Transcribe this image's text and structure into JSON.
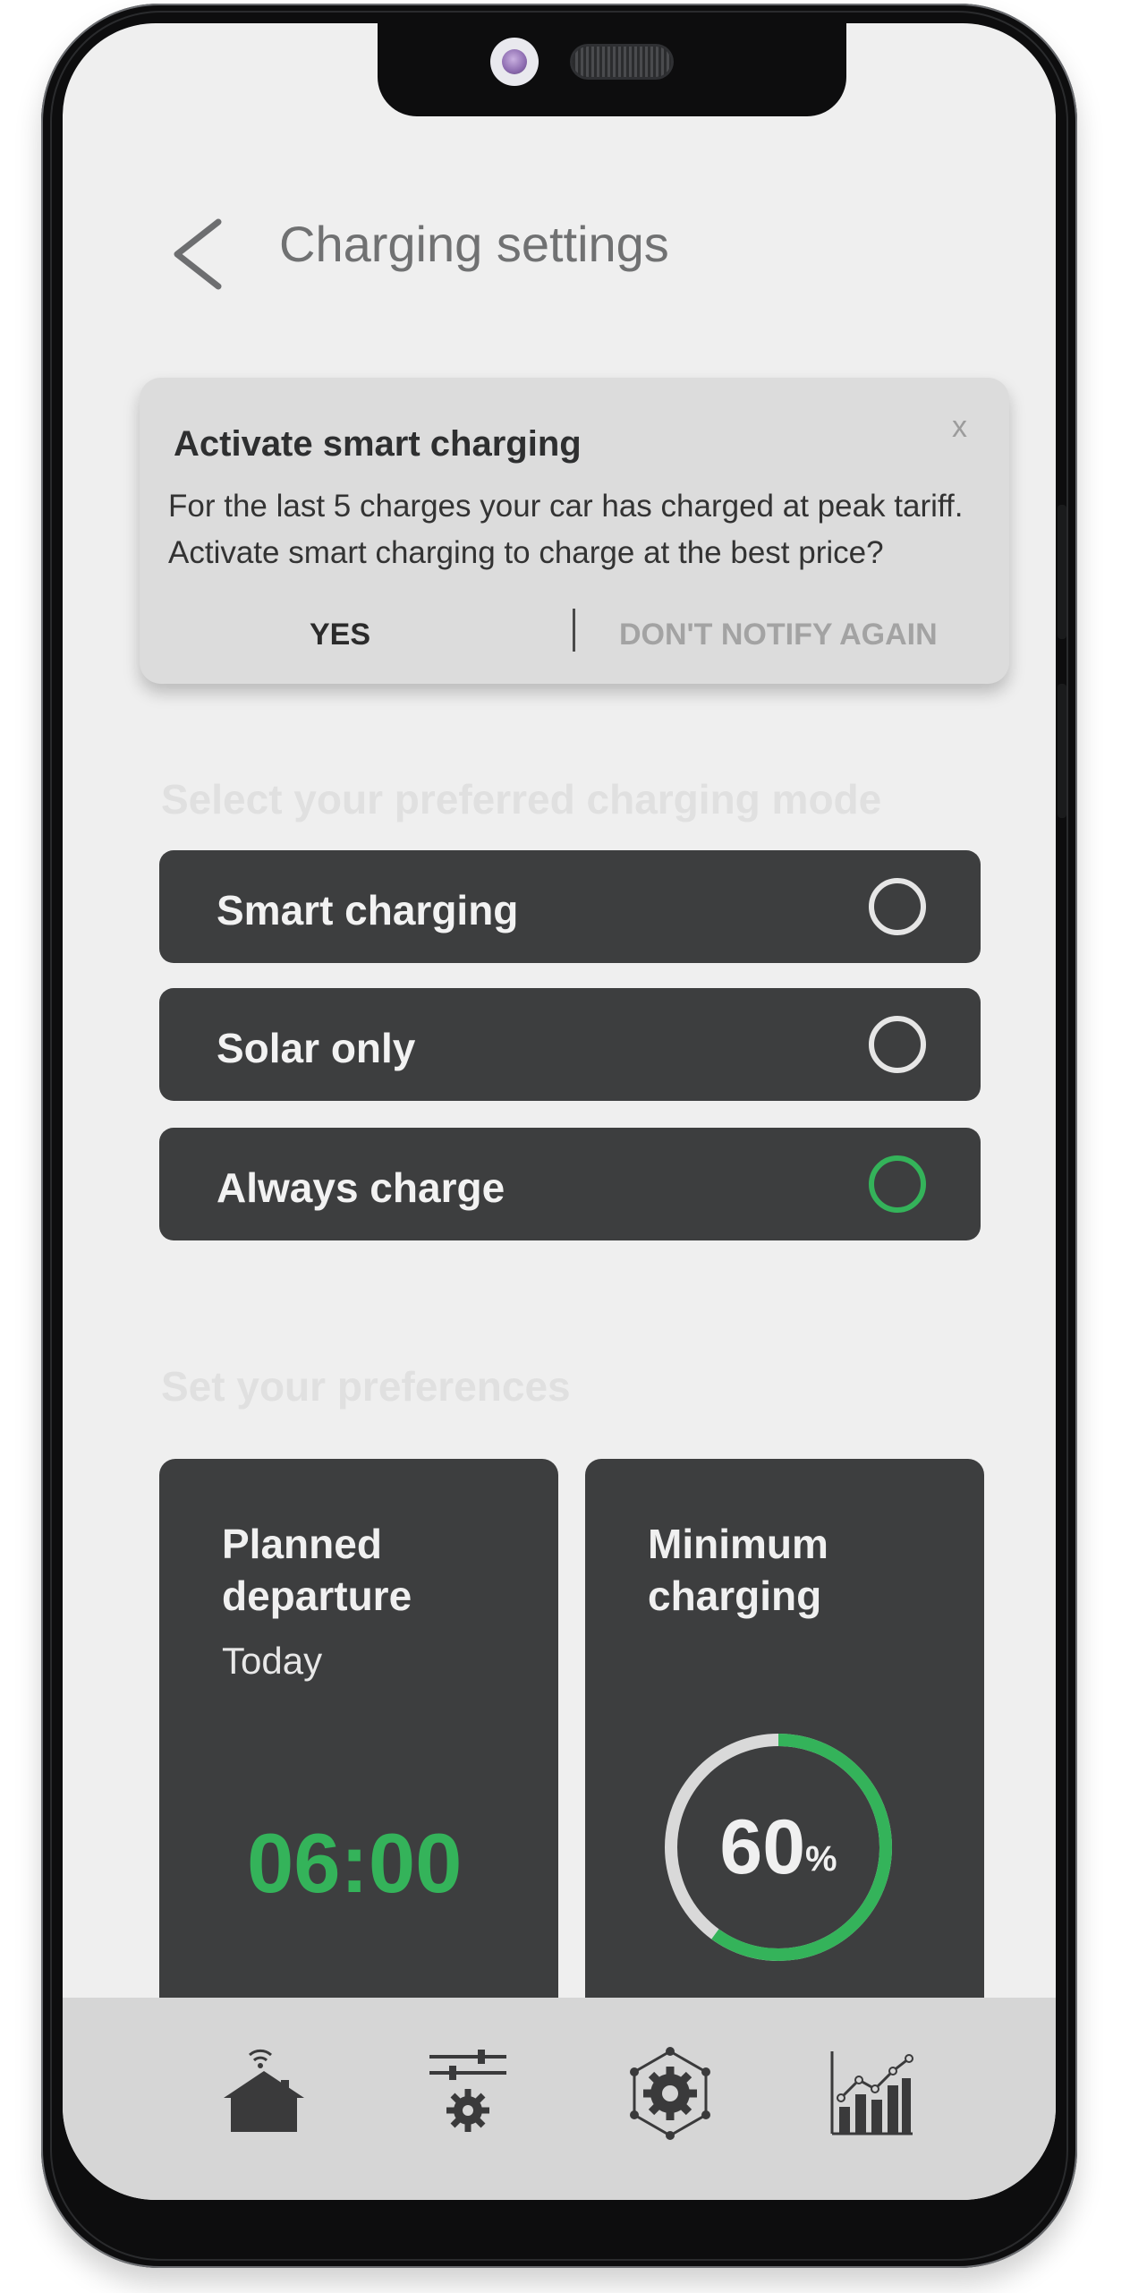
{
  "header": {
    "title": "Charging settings"
  },
  "notification": {
    "title": "Activate smart charging",
    "line1": "For the last 5 charges your car has charged at peak tariff.",
    "line2": "Activate smart charging to charge at the best price?",
    "confirm_label": "YES",
    "dismiss_label": "DON'T NOTIFY AGAIN",
    "close_label": "x"
  },
  "charging_mode": {
    "heading": "Select your preferred charging mode",
    "options": [
      {
        "label": "Smart charging",
        "selected": false
      },
      {
        "label": "Solar only",
        "selected": false
      },
      {
        "label": "Always charge",
        "selected": true
      }
    ]
  },
  "preferences": {
    "heading": "Set your preferences",
    "departure": {
      "title": "Planned departure",
      "day": "Today",
      "time": "06:00"
    },
    "minimum": {
      "title": "Minimum charging",
      "value": "60",
      "unit": "%",
      "fraction": 0.6
    }
  },
  "tabbar": {
    "items": [
      {
        "icon": "smart-home-icon"
      },
      {
        "icon": "settings-sliders-icon"
      },
      {
        "icon": "network-gear-icon"
      },
      {
        "icon": "chart-icon"
      }
    ]
  },
  "colors": {
    "accent_green": "#34b35a",
    "card_bg": "#3d3e3f",
    "screen_bg": "#efefef"
  }
}
